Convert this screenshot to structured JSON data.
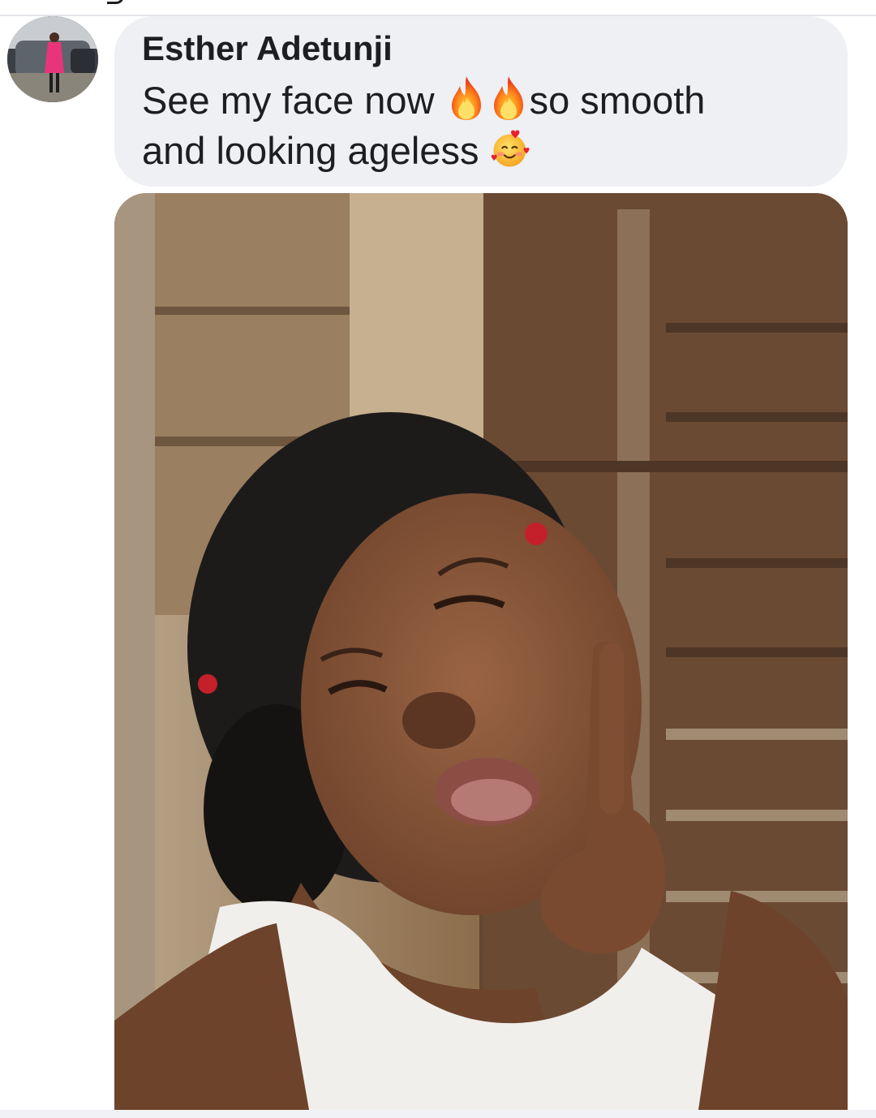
{
  "comment": {
    "author": "Esther Adetunji",
    "text_line1": "See my face now",
    "text_line1_after": "so smooth",
    "text_line2": "and looking ageless",
    "emojis": [
      "fire-icon",
      "fire-icon",
      "smiling-face-with-hearts-icon"
    ]
  },
  "colors": {
    "bubble_background": "#eef0f3",
    "text": "#1c1e21"
  }
}
